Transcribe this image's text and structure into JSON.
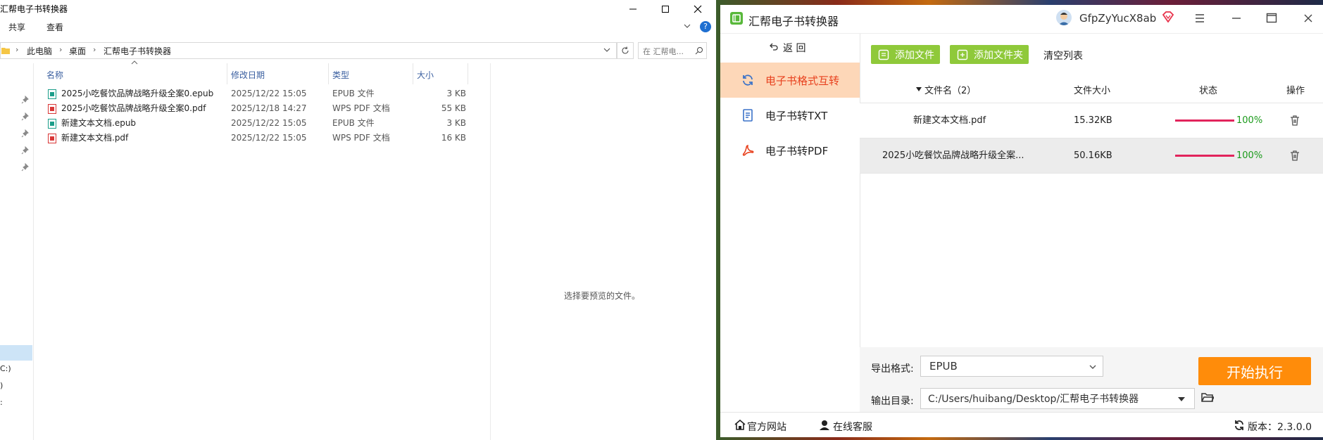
{
  "explorer": {
    "title": "汇帮电子书转换器",
    "ribbon": [
      "共享",
      "查看"
    ],
    "breadcrumb": [
      "此电脑",
      "桌面",
      "汇帮电子书转换器"
    ],
    "search_placeholder": "在 汇帮电...",
    "columns": {
      "name": "名称",
      "date": "修改日期",
      "type": "类型",
      "size": "大小"
    },
    "files": [
      {
        "name": "2025小吃餐饮品牌战略升级全案0.epub",
        "date": "2025/12/22 15:05",
        "type": "EPUB 文件",
        "size": "3 KB",
        "kind": "epub"
      },
      {
        "name": "2025小吃餐饮品牌战略升级全案0.pdf",
        "date": "2025/12/18 14:27",
        "type": "WPS PDF 文档",
        "size": "55 KB",
        "kind": "pdf"
      },
      {
        "name": "新建文本文档.epub",
        "date": "2025/12/22 15:05",
        "type": "EPUB 文件",
        "size": "3 KB",
        "kind": "epub"
      },
      {
        "name": "新建文本文档.pdf",
        "date": "2025/12/22 15:05",
        "type": "WPS PDF 文档",
        "size": "16 KB",
        "kind": "pdf"
      }
    ],
    "preview_text": "选择要预览的文件。",
    "nav_drives": [
      "C:)",
      ")",
      ":"
    ]
  },
  "app": {
    "title": "汇帮电子书转换器",
    "username": "GfpZyYucX8ab",
    "back_label": "返 回",
    "sidebar": [
      {
        "label": "电子书格式互转",
        "icon": "refresh-icon",
        "active": true
      },
      {
        "label": "电子书转TXT",
        "icon": "document-icon",
        "active": false
      },
      {
        "label": "电子书转PDF",
        "icon": "pdf-icon",
        "active": false
      }
    ],
    "toolbar": {
      "add_file": "添加文件",
      "add_folder": "添加文件夹",
      "clear_list": "清空列表"
    },
    "table_headers": {
      "name": "文件名（2）",
      "size": "文件大小",
      "status": "状态",
      "action": "操作"
    },
    "rows": [
      {
        "name": "新建文本文档.pdf",
        "size": "15.32KB",
        "progress": 100,
        "percent": "100%"
      },
      {
        "name": "2025小吃餐饮品牌战略升级全案...",
        "size": "50.16KB",
        "progress": 100,
        "percent": "100%"
      }
    ],
    "export_format_label": "导出格式:",
    "export_format_value": "EPUB",
    "output_dir_label": "输出目录:",
    "output_dir_value": "C:/Users/huibang/Desktop/汇帮电子书转换器",
    "start_button": "开始执行",
    "footer": {
      "website": "官方网站",
      "support": "在线客服",
      "version": "版本：2.3.0.0"
    },
    "colors": {
      "accent_orange": "#ff8c0a",
      "green_button": "#8fc93a",
      "progress": "#e2245c",
      "active_bg": "#fdd7b8",
      "active_text": "#e8411e"
    }
  }
}
